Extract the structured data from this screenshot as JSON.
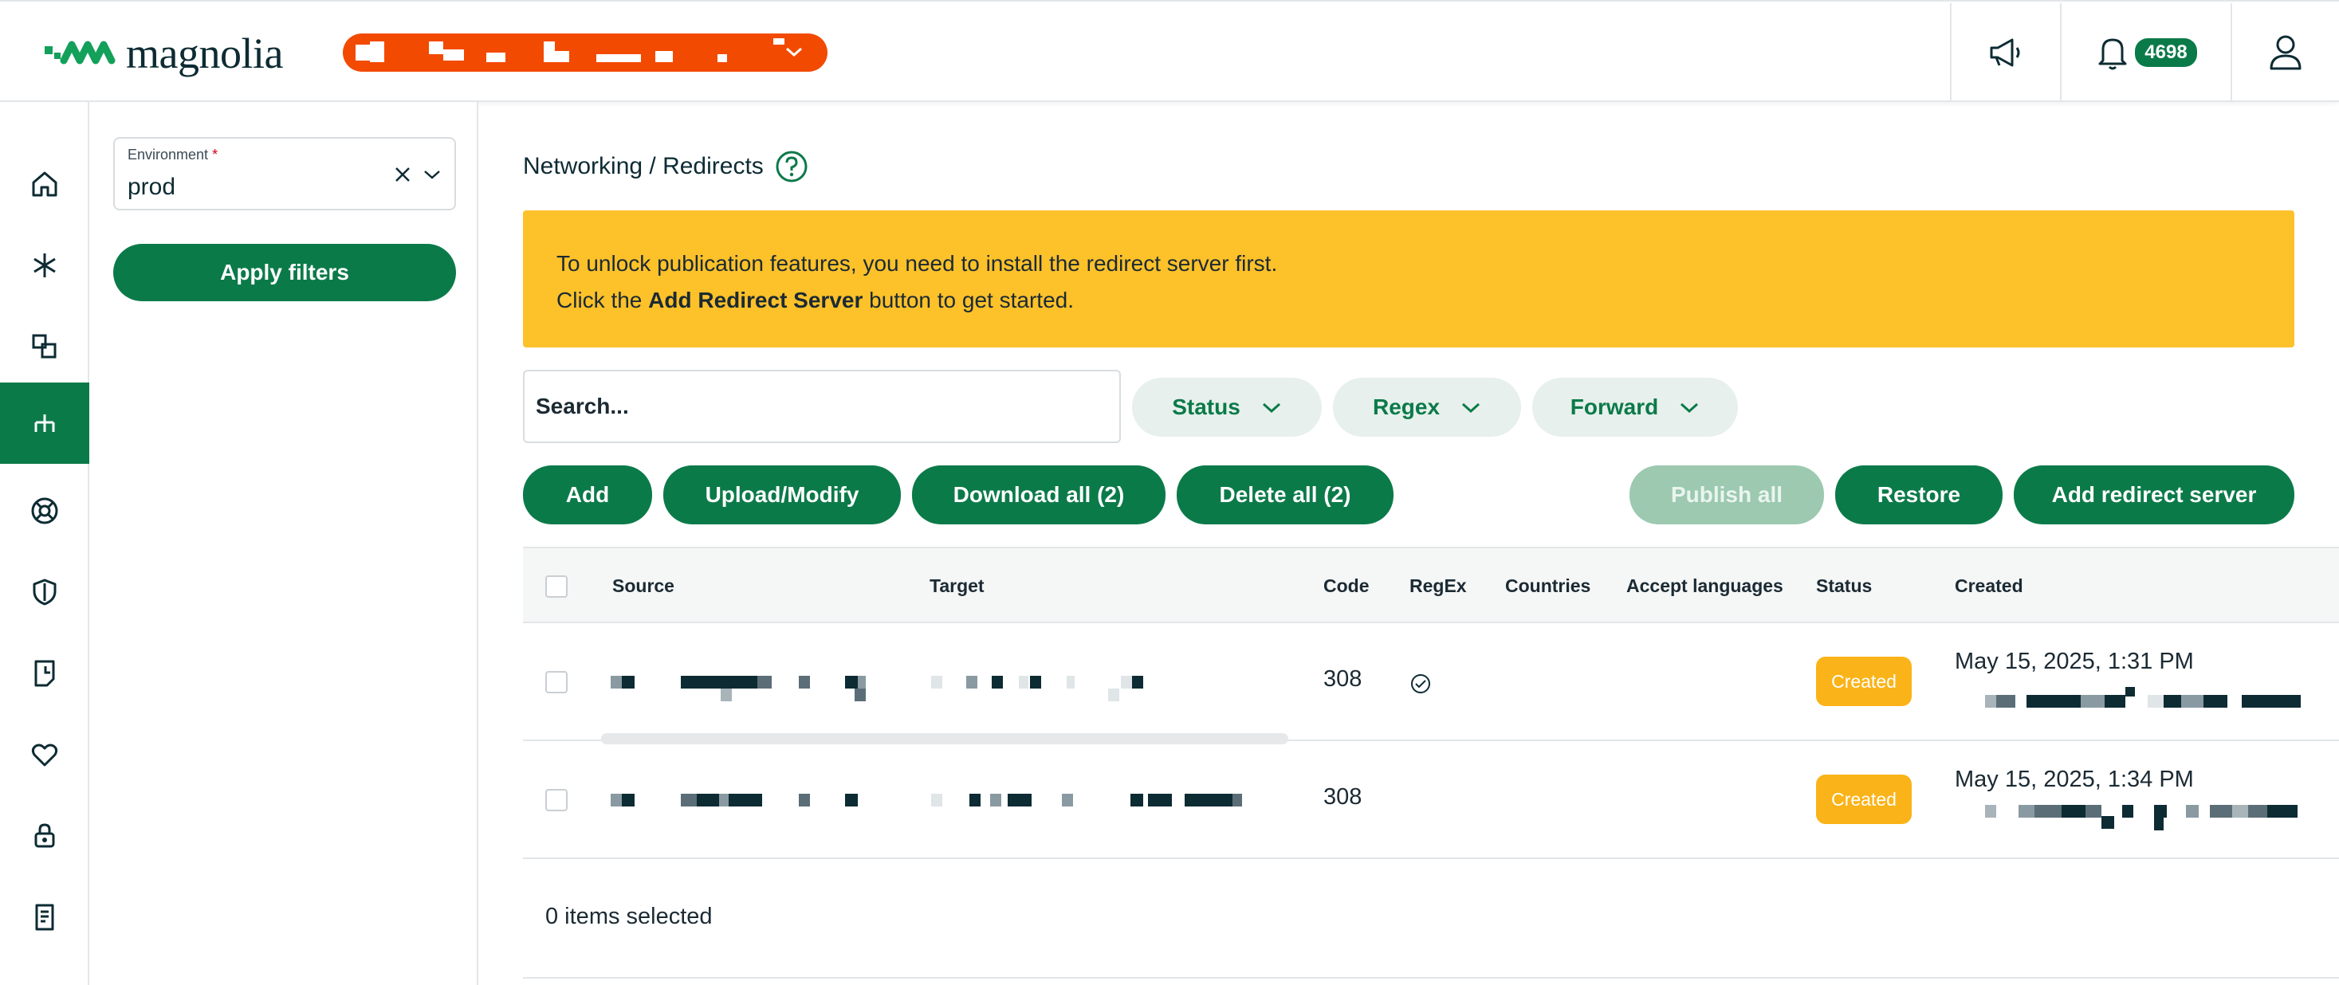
{
  "header": {
    "logo_text": "magnolia",
    "notifications_count": "4698",
    "brand_color": "#0b7a49",
    "site_selector_color": "#f24a00"
  },
  "rail": {
    "items": [
      {
        "name": "home-icon",
        "active": false
      },
      {
        "name": "asterisk-icon",
        "active": false
      },
      {
        "name": "shapes-icon",
        "active": false
      },
      {
        "name": "redirects-icon",
        "active": true
      },
      {
        "name": "lifebuoy-icon",
        "active": false
      },
      {
        "name": "shield-icon",
        "active": false
      },
      {
        "name": "document-icon",
        "active": false
      },
      {
        "name": "heart-icon",
        "active": false
      },
      {
        "name": "lock-icon",
        "active": false
      },
      {
        "name": "page-icon",
        "active": false
      }
    ]
  },
  "filters": {
    "environment_label": "Environment",
    "environment_required_mark": "*",
    "environment_value": "prod",
    "apply_label": "Apply filters"
  },
  "main": {
    "breadcrumb": "Networking / Redirects",
    "banner_line1": "To unlock publication features, you need to install the redirect server first.",
    "banner_line2_prefix": "Click the ",
    "banner_line2_bold": "Add Redirect Server",
    "banner_line2_suffix": " button to get started.",
    "search_placeholder": "Search...",
    "filter_chips": [
      "Status",
      "Regex",
      "Forward"
    ],
    "actions": {
      "add": "Add",
      "upload": "Upload/Modify",
      "download_all": "Download all (2)",
      "delete_all": "Delete all (2)",
      "publish_all": "Publish all",
      "restore": "Restore",
      "add_redirect_server": "Add redirect server"
    }
  },
  "table": {
    "columns": [
      "Source",
      "Target",
      "Code",
      "RegEx",
      "Countries",
      "Accept languages",
      "Status",
      "Created"
    ],
    "rows": [
      {
        "code": "308",
        "regex": true,
        "status": "Created",
        "created": "May 15, 2025, 1:31 PM"
      },
      {
        "code": "308",
        "regex": false,
        "status": "Created",
        "created": "May 15, 2025, 1:34 PM"
      }
    ],
    "selection_text": "0 items selected"
  },
  "colors": {
    "banner": "#fdc12a",
    "status_badge": "#fab318",
    "chip_bg": "#e7f0ec"
  }
}
